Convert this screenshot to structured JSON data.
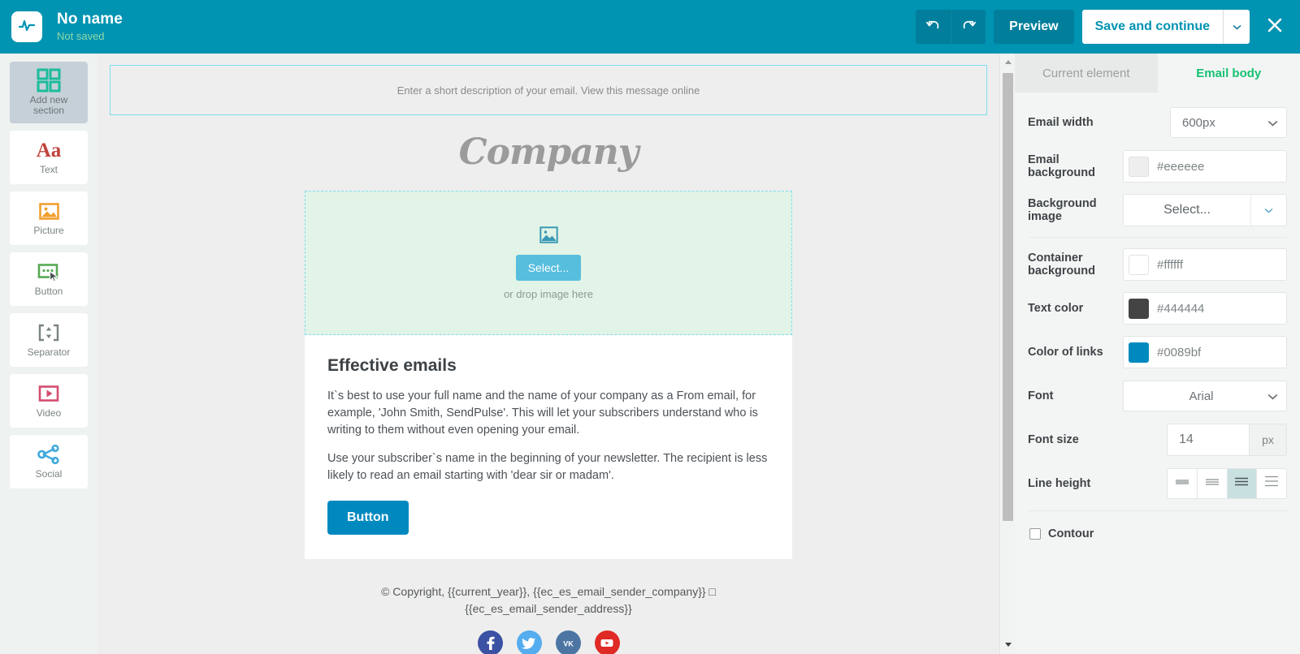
{
  "header": {
    "logo_icon": "pulse-activity-icon",
    "title": "No name",
    "subtitle": "Not saved",
    "undo_icon": "undo-arrow-icon",
    "redo_icon": "redo-arrow-icon",
    "preview_label": "Preview",
    "save_label": "Save and continue",
    "save_caret_icon": "chevron-down-icon",
    "close_icon": "close-x-icon",
    "bar_color": "#0093b2",
    "button_color": "#007e9b"
  },
  "sidebar": {
    "items": [
      {
        "label": "Add new\nsection",
        "label_line1": "Add new",
        "label_line2": "section",
        "icon": "grid-squares-icon",
        "color": "#1bbc9b",
        "active": true
      },
      {
        "label": "Text",
        "icon": "text-aa-icon",
        "color": "#c0443c",
        "active": false
      },
      {
        "label": "Picture",
        "icon": "picture-image-icon",
        "color": "#f0a030",
        "active": false
      },
      {
        "label": "Button",
        "icon": "button-cursor-icon",
        "color": "#58a955",
        "active": false
      },
      {
        "label": "Separator",
        "icon": "separator-arrows-icon",
        "color": "#7b8384",
        "active": false
      },
      {
        "label": "Video",
        "icon": "video-play-icon",
        "color": "#d44d6e",
        "active": false
      },
      {
        "label": "Social",
        "icon": "social-share-icon",
        "color": "#3fa9dc",
        "active": false
      }
    ]
  },
  "canvas": {
    "preheader_text": "Enter a short description of your email. View this message online",
    "company_logo_text": "Company",
    "image_block": {
      "icon": "image-placeholder-icon",
      "select_label": "Select...",
      "drop_hint": "or drop image here",
      "background": "#e2f4e7"
    },
    "text_block": {
      "heading": "Effective emails",
      "paragraph_1": "It`s best to use your full name and the name of your company as a From email, for example, 'John Smith, SendPulse'. This will let your subscribers understand who is writing to them without even opening your email.",
      "paragraph_2": "Use your subscriber`s name in the beginning of your newsletter. The recipient is less likely to read an email starting with 'dear sir or madam'."
    },
    "cta_button_label": "Button",
    "footer": {
      "copyright_line_1": "© Copyright, {{current_year}}, {{ec_es_email_sender_company}} □",
      "copyright_line_2": "{{ec_es_email_sender_address}}",
      "socials": [
        {
          "name": "facebook",
          "glyph": "f",
          "color": "#3b51a3"
        },
        {
          "name": "twitter",
          "glyph": "t",
          "color": "#55acee"
        },
        {
          "name": "vk",
          "glyph": "vk",
          "color": "#4c75a3"
        },
        {
          "name": "youtube",
          "glyph": "y",
          "color": "#e02a26"
        }
      ]
    },
    "scrollbar": {
      "up_icon": "scroll-up-arrow-icon",
      "down_icon": "scroll-down-arrow-icon"
    }
  },
  "panel": {
    "tabs": [
      {
        "label": "Current element",
        "active": false
      },
      {
        "label": "Email body",
        "active": true
      }
    ],
    "active_tab_color": "#16c172",
    "fields": {
      "email_width": {
        "label": "Email width",
        "value": "600px",
        "caret_icon": "chevron-down-icon"
      },
      "email_background": {
        "label": "Email background",
        "value": "#eeeeee",
        "swatch": "#eeeeee"
      },
      "background_image": {
        "label": "Background image",
        "value": "Select...",
        "caret_icon": "chevron-down-icon"
      },
      "container_background": {
        "label": "Container background",
        "value": "#ffffff",
        "swatch": "#ffffff"
      },
      "text_color": {
        "label": "Text color",
        "value": "#444444",
        "swatch": "#444444"
      },
      "color_of_links": {
        "label": "Color of links",
        "value": "#0089bf",
        "swatch": "#0089bf"
      },
      "font": {
        "label": "Font",
        "value": "Arial",
        "caret_icon": "chevron-down-icon"
      },
      "font_size": {
        "label": "Font size",
        "value": "14",
        "unit": "px"
      },
      "line_height": {
        "label": "Line height",
        "options": [
          "tight",
          "normal",
          "relaxed",
          "loose"
        ],
        "selected_index": 2
      },
      "contour": {
        "label": "Contour",
        "checked": false
      }
    },
    "scrollbar": {
      "up_icon": "scroll-up-arrow-icon",
      "down_icon": "scroll-down-arrow-icon"
    }
  }
}
